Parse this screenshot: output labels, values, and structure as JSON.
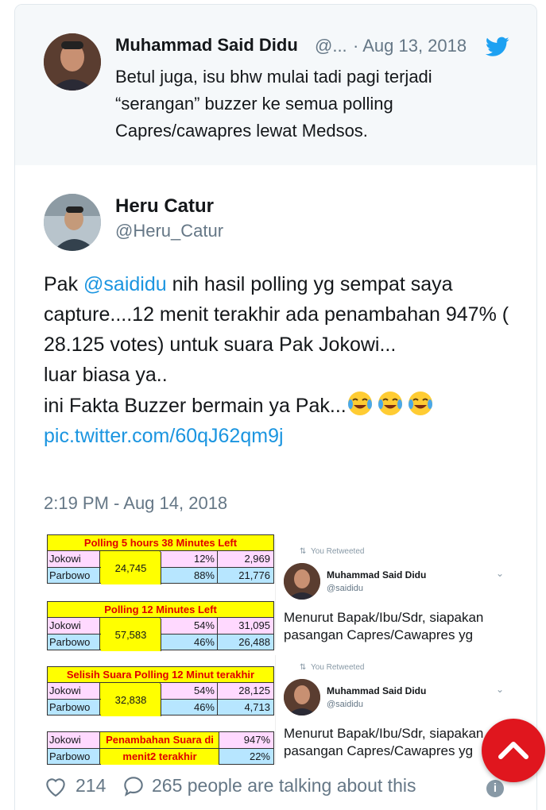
{
  "quoted_tweet": {
    "name": "Muhammad Said Didu",
    "handle": "@...",
    "date": "· Aug 13, 2018",
    "text": "Betul juga, isu bhw mulai tadi pagi terjadi “serangan” buzzer ke semua polling Capres/cawapres lewat Medsos."
  },
  "tweet": {
    "name": "Heru Catur",
    "handle": "@Heru_Catur",
    "text_prefix": "Pak ",
    "mention": "@saididu",
    "text_main": " nih hasil polling yg sempat saya capture....12 menit terakhir ada penambahan 947% ( 28.125 votes) untuk suara Pak Jokowi...",
    "line2": "luar biasa ya..",
    "line3": "ini Fakta Buzzer bermain ya Pak...",
    "emojis": [
      "😂",
      "😂",
      "😂"
    ],
    "pic_link": "pic.twitter.com/60qJ62qm9j",
    "timestamp": "2:19 PM - Aug 14, 2018"
  },
  "media": {
    "table1": {
      "title": "Polling 5 hours 38 Minutes Left",
      "rows": [
        {
          "label": "Jokowi",
          "pct": "12%",
          "votes": "2,969"
        },
        {
          "label": "Parbowo",
          "pct": "88%",
          "votes": "21,776"
        }
      ],
      "total": "24,745"
    },
    "table2": {
      "title": "Polling  12 Minutes Left",
      "rows": [
        {
          "label": "Jokowi",
          "pct": "54%",
          "votes": "31,095"
        },
        {
          "label": "Parbowo",
          "pct": "46%",
          "votes": "26,488"
        }
      ],
      "total": "57,583"
    },
    "table3": {
      "title": "Selisih Suara Polling  12 Minut terakhir",
      "rows": [
        {
          "label": "Jokowi",
          "pct": "54%",
          "votes": "28,125"
        },
        {
          "label": "Parbowo",
          "pct": "46%",
          "votes": "4,713"
        }
      ],
      "total": "32,838"
    },
    "table4": {
      "rows": [
        {
          "label": "Jokowi",
          "mid": "Penambahan Suara di",
          "pct": "947%"
        },
        {
          "label": "Parbowo",
          "mid": "menit2 terakhir",
          "pct": "22%"
        }
      ]
    },
    "retweet_cards": [
      {
        "label": "You Retweeted",
        "name": "Muhammad Said Didu",
        "handle": "@saididu",
        "text": "Menurut Bapak/Ibu/Sdr, siapakan pasangan Capres/Cawapres yg"
      },
      {
        "label": "You Retweeted",
        "name": "Muhammad Said Didu",
        "handle": "@saididu",
        "text": "Menurut Bapak/Ibu/Sdr, siapakan pasangan Capres/Cawapres yg"
      }
    ]
  },
  "footer": {
    "likes": "214",
    "talking": "265 people are talking about this",
    "heart_icon": "heart-icon",
    "comment_icon": "speech-bubble-icon",
    "info_icon": "info-icon"
  },
  "colors": {
    "link": "#1b95e0",
    "fab": "#e0161e",
    "twitter_blue": "#1da1f2"
  }
}
